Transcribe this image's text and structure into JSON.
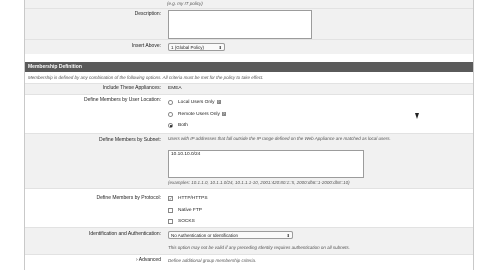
{
  "top": {
    "hint_example": "(e.g. my IT policy)",
    "description_label": "Description:",
    "insert_above_label": "Insert Above:",
    "insert_above_value": "1 (Global Policy)"
  },
  "section": {
    "title": "Membership Definition",
    "intro": "Membership is defined by any combination of the following options. All criteria must be met for the policy to take effect."
  },
  "appliances": {
    "label": "Include These Appliances:",
    "value": "EMEA"
  },
  "location": {
    "label": "Define Members by User Location:",
    "options": [
      "Local Users Only",
      "Remote Users Only",
      "Both"
    ],
    "help_glyph": "?"
  },
  "subnet": {
    "label": "Define Members by Subnet:",
    "description": "Users with IP addresses that fall outside the IP range defined on the Web Appliance are matched as local users.",
    "value": "10.10.10.0/24",
    "examples": "(examples: 10.1.1.0, 10.1.1.0/24, 10.1.1.1-10, 2001:420:80:1::5, 2000:db8::1-2000:db8::10)"
  },
  "protocol": {
    "label": "Define Members by Protocol:",
    "options": [
      "HTTP/HTTPS",
      "Native FTP",
      "SOCKS"
    ],
    "check_glyph": "✓"
  },
  "auth": {
    "label": "Identification and Authentication:",
    "value": "No Authentication or Identification",
    "note": "This option may not be valid if any preceding Identity requires authentication on all subnets."
  },
  "advanced": {
    "label": "Advanced",
    "arrow": "›",
    "description": "Define additional group membership criteria."
  },
  "glyphs": {
    "caret": "⬍"
  }
}
